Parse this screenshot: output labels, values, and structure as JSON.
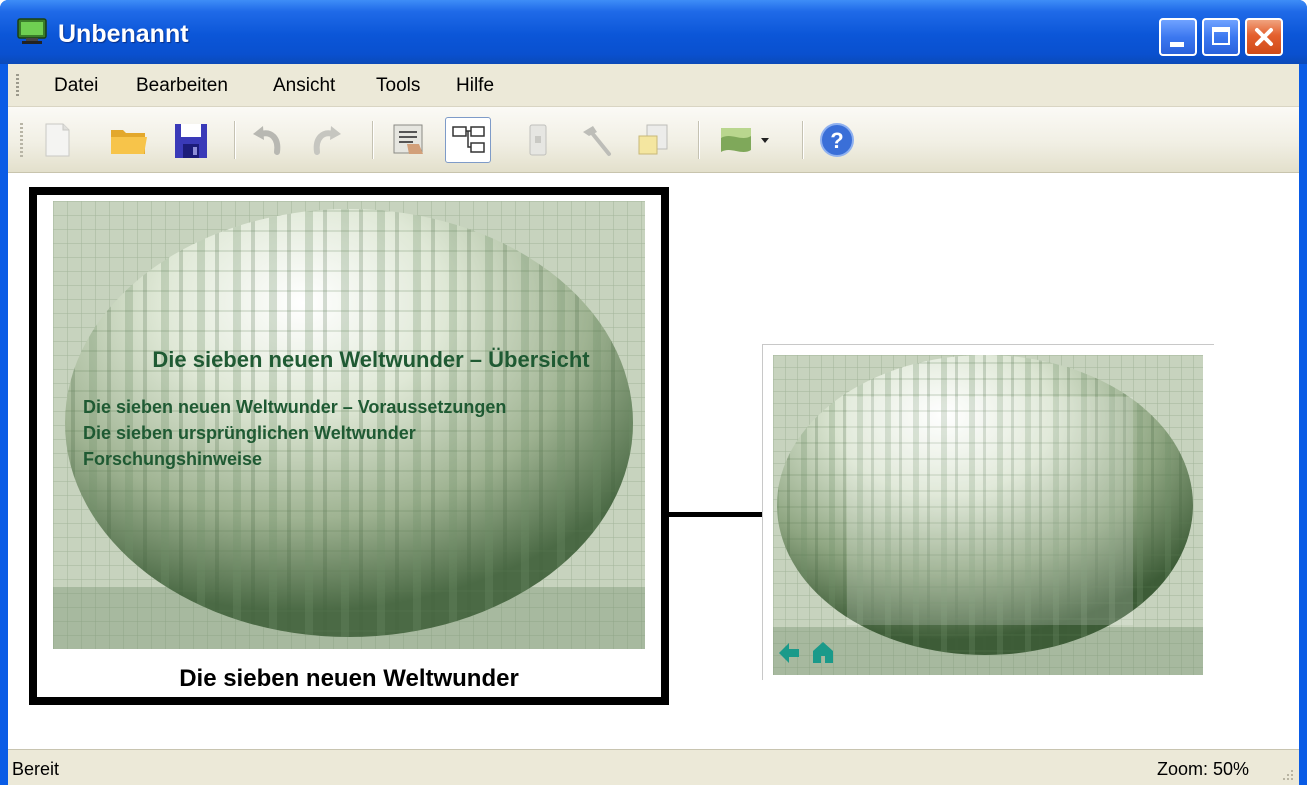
{
  "window": {
    "title": "Unbenannt"
  },
  "menu": {
    "items": [
      {
        "label": "Datei"
      },
      {
        "label": "Bearbeiten"
      },
      {
        "label": "Ansicht"
      },
      {
        "label": "Tools"
      },
      {
        "label": "Hilfe"
      }
    ]
  },
  "toolbar": {
    "buttons": [
      {
        "icon": "new-document-icon"
      },
      {
        "icon": "open-folder-icon"
      },
      {
        "icon": "save-disk-icon"
      },
      {
        "icon": "undo-icon"
      },
      {
        "icon": "redo-icon"
      },
      {
        "icon": "presenter-icon"
      },
      {
        "icon": "tree-view-icon",
        "active": true
      },
      {
        "icon": "page-icon"
      },
      {
        "icon": "hammer-icon"
      },
      {
        "icon": "export-icon"
      },
      {
        "icon": "theme-icon",
        "dropdown": true
      },
      {
        "icon": "help-icon"
      }
    ]
  },
  "slide_main": {
    "title": "Die sieben neuen Weltwunder – Übersicht",
    "links": [
      "Die sieben neuen Weltwunder – Voraussetzungen",
      "Die sieben ursprünglichen Weltwunder",
      "Forschungshinweise"
    ],
    "caption": "Die sieben neuen Weltwunder"
  },
  "status": {
    "text": "Bereit",
    "zoom": "Zoom: 50%"
  },
  "colors": {
    "title_bar": "#0a56d8",
    "slide_text": "#1f5a33",
    "nav_icons": "#1a9a8a"
  }
}
